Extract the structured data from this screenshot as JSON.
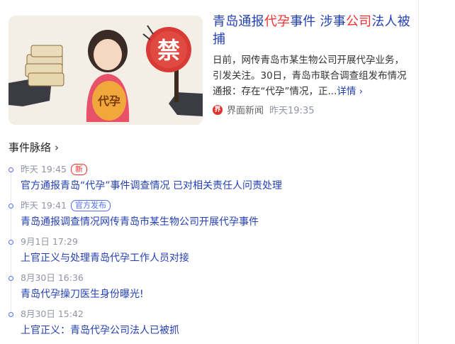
{
  "news": {
    "title_parts": [
      {
        "text": "青岛通报",
        "highlight": false
      },
      {
        "text": "代孕",
        "highlight": true
      },
      {
        "text": "事件 涉事",
        "highlight": false
      },
      {
        "text": "公司",
        "highlight": true
      },
      {
        "text": "法人被捕",
        "highlight": false
      }
    ],
    "abstract": "日前，网传青岛市某生物公司开展代孕业务，引发关注。30日，青岛市联合调查组发布情况通报：存在“代孕”情况，正...",
    "more_label": "详情",
    "more_icon": "chevron-right-icon",
    "source_name": "界面新闻",
    "source_time": "昨天19:35",
    "source_logo_icon": "jiemian-logo-icon",
    "image_sign_text": "禁",
    "image_belly_text": "代孕"
  },
  "timeline": {
    "header": "事件脉络",
    "header_icon": "chevron-right-icon",
    "items": [
      {
        "time": "昨天 19:45",
        "badge": "新",
        "badge_type": "new",
        "title": "官方通报青岛“代孕”事件调查情况 已对相关责任人问责处理"
      },
      {
        "time": "昨天 19:41",
        "badge": "官方发布",
        "badge_type": "official",
        "title": "青岛通报调查情况网传青岛市某生物公司开展代孕事件"
      },
      {
        "time": "9月1日 17:29",
        "badge": "",
        "badge_type": "",
        "title": "上官正义与处理青岛代孕工作人员对接"
      },
      {
        "time": "8月30日 16:36",
        "badge": "",
        "badge_type": "",
        "title": "青岛代孕操刀医生身份曝光!"
      },
      {
        "time": "8月30日 15:42",
        "badge": "",
        "badge_type": "",
        "title": "上官正义：青岛代孕公司法人已被抓"
      }
    ]
  },
  "colors": {
    "link": "#2440b3",
    "highlight": "#f73131",
    "accent": "#4e6ef2",
    "meta": "#9195a3"
  }
}
